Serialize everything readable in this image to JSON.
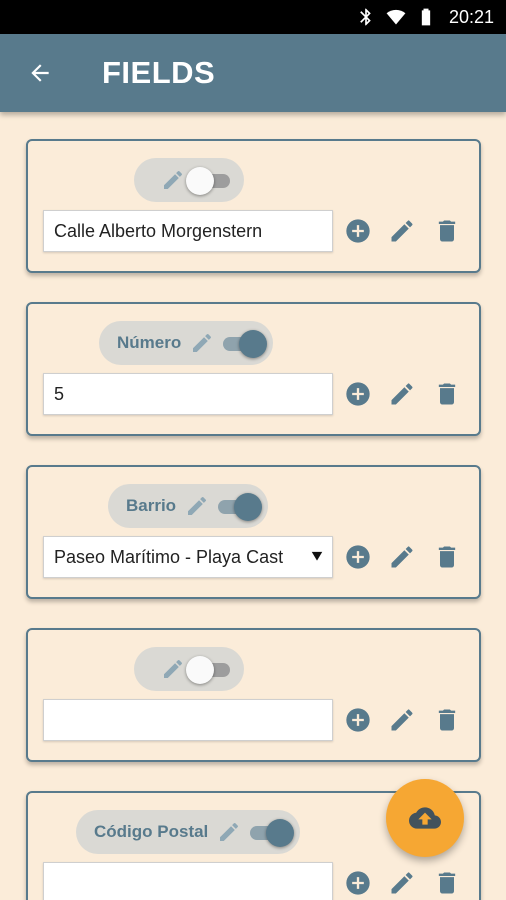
{
  "status_bar": {
    "time": "20:21"
  },
  "app_bar": {
    "title": "FIELDS"
  },
  "cards": [
    {
      "label": "",
      "switch": "off",
      "value": "Calle Alberto Morgenstern",
      "is_select": false
    },
    {
      "label": "Número",
      "switch": "on",
      "value": "5",
      "is_select": false
    },
    {
      "label": "Barrio",
      "switch": "on",
      "value": "Paseo Marítimo - Playa Cast",
      "is_select": true
    },
    {
      "label": "",
      "switch": "off",
      "value": "",
      "is_select": false
    },
    {
      "label": "Código Postal",
      "switch": "on",
      "value": "",
      "is_select": false
    }
  ],
  "fab": {
    "icon": "cloud-upload-icon",
    "color": "#f6a733"
  },
  "colors": {
    "primary": "#587a8c",
    "background": "#fbecd9",
    "accent": "#f6a733"
  }
}
